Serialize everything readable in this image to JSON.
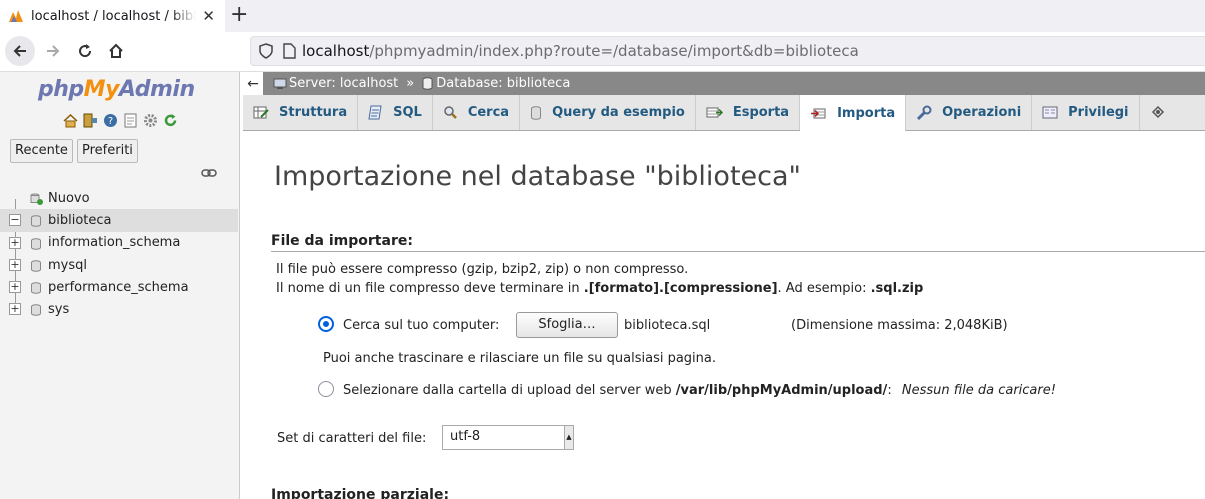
{
  "browser": {
    "tab_title": "localhost / localhost / biblioteca | phpMyAdmin",
    "url_host": "localhost",
    "url_path": "/phpmyadmin/index.php?route=/database/import&db=biblioteca"
  },
  "sidebar": {
    "logo_php": "php",
    "logo_my": "My",
    "logo_admin": "Admin",
    "recent_label": "Recente",
    "favorites_label": "Preferiti",
    "tree": [
      {
        "label": "Nuovo"
      },
      {
        "label": "biblioteca"
      },
      {
        "label": "information_schema"
      },
      {
        "label": "mysql"
      },
      {
        "label": "performance_schema"
      },
      {
        "label": "sys"
      }
    ]
  },
  "breadcrumb": {
    "server": "Server: localhost",
    "separator": "»",
    "database": "Database: biblioteca"
  },
  "tabs": [
    {
      "label": "Struttura"
    },
    {
      "label": "SQL"
    },
    {
      "label": "Cerca"
    },
    {
      "label": "Query da esempio"
    },
    {
      "label": "Esporta"
    },
    {
      "label": "Importa"
    },
    {
      "label": "Operazioni"
    },
    {
      "label": "Privilegi"
    }
  ],
  "main": {
    "title": "Importazione nel database \"biblioteca\"",
    "file_section_title": "File da importare:",
    "info_line1": "Il file può essere compresso (gzip, bzip2, zip) o non compresso.",
    "info_line2_pre": "Il nome di un file compresso deve terminare in ",
    "info_line2_bold": ".[formato].[compressione]",
    "info_line2_mid": ". Ad esempio: ",
    "info_line2_bold2": ".sql.zip",
    "option_computer_label": "Cerca sul tuo computer:",
    "browse_label": "Sfoglia…",
    "selected_file": "biblioteca.sql",
    "max_size": "(Dimensione massima: 2,048KiB)",
    "drag_hint": "Puoi anche trascinare e rilasciare un file su qualsiasi pagina.",
    "option_server_label": "Selezionare dalla cartella di upload del server web ",
    "upload_dir": "/var/lib/phpMyAdmin/upload/",
    "upload_dir_suffix": ":",
    "no_files": "Nessun file da caricare!",
    "charset_label": "Set di caratteri del file:",
    "charset_value": "utf-8",
    "partial_section_title": "Importazione parziale:"
  },
  "colors": {
    "logo_blue": "#6c78af",
    "logo_orange": "#f29111",
    "tab_text": "#235a81",
    "breadcrumb_bg": "#888888",
    "radio_accent": "#0061e0"
  }
}
